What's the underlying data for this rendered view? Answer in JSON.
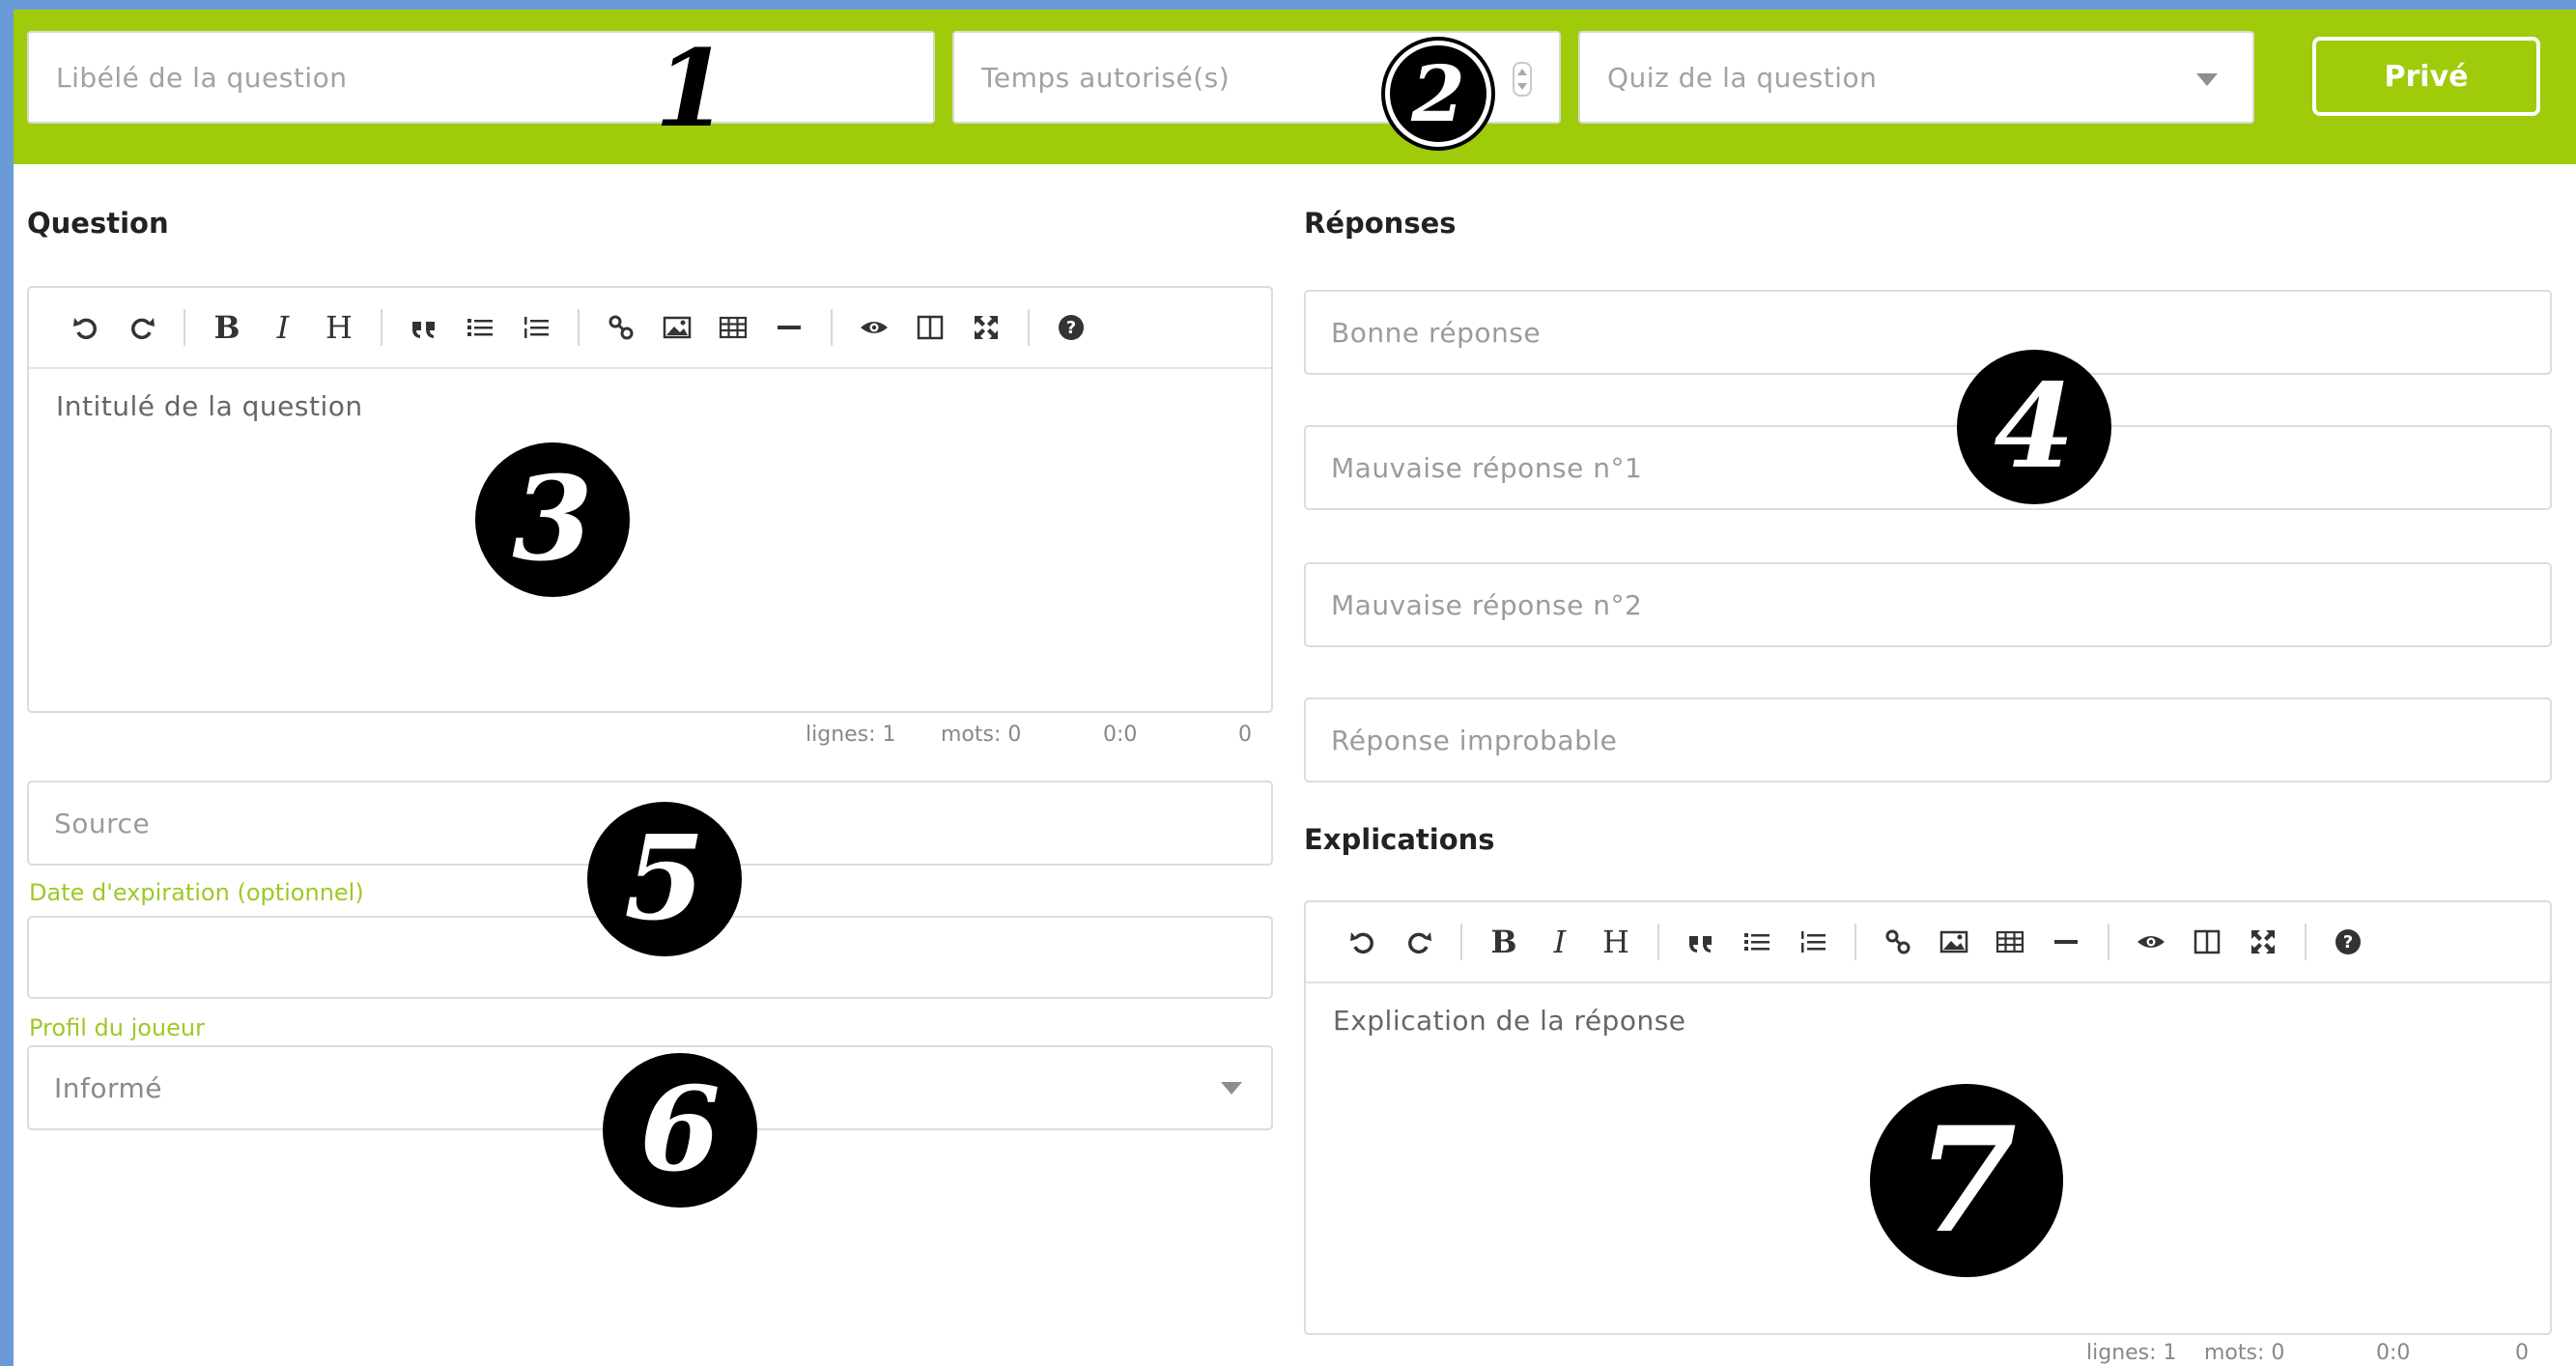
{
  "header": {
    "question_label_placeholder": "Libélé de la question",
    "time_placeholder": "Temps autorisé(s)",
    "quiz_select_placeholder": "Quiz de la question",
    "private_button": "Privé"
  },
  "question": {
    "section_title": "Question",
    "editor_placeholder": "Intitulé de la question",
    "status": {
      "lines": "lignes: 1",
      "words": "mots: 0",
      "cursor": "0:0",
      "chars": "0"
    }
  },
  "source": {
    "placeholder": "Source",
    "expiration_label": "Date d'expiration (optionnel)",
    "expiration_value": "",
    "player_profile_label": "Profil du joueur",
    "player_profile_value": "Informé"
  },
  "answers": {
    "section_title": "Réponses",
    "good_answer_placeholder": "Bonne réponse",
    "wrong_answer_1_placeholder": "Mauvaise réponse n°1",
    "wrong_answer_2_placeholder": "Mauvaise réponse n°2",
    "improbable_answer_placeholder": "Réponse improbable"
  },
  "explanations": {
    "section_title": "Explications",
    "editor_placeholder": "Explication de la réponse",
    "status": {
      "lines": "lignes: 1",
      "words": "mots: 0",
      "cursor": "0:0",
      "chars": "0"
    }
  },
  "markers": [
    "1",
    "2",
    "3",
    "4",
    "5",
    "6",
    "7"
  ],
  "colors": {
    "accent": "#9fcb0b",
    "label_green": "#9ec925",
    "frame": "#6a9bd8"
  }
}
